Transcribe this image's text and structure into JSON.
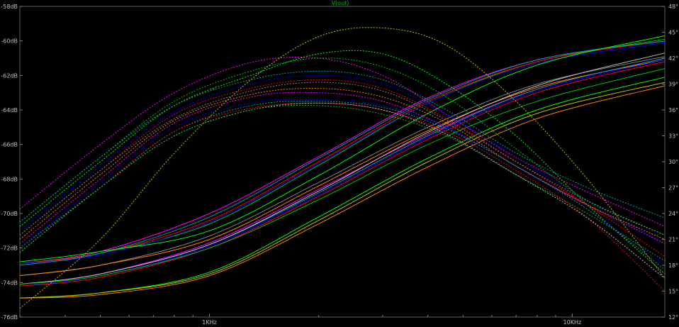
{
  "chart_data": {
    "type": "line",
    "title": "V(out)",
    "x_scale": "log",
    "xlim": [
      300,
      18000
    ],
    "x_ticks": [
      {
        "value": 1000,
        "label": "1KHz"
      },
      {
        "value": 10000,
        "label": "10KHz"
      }
    ],
    "y_left_lim": [
      -76,
      -58
    ],
    "y_left_ticks": [
      {
        "value": -58,
        "label": "-58dB"
      },
      {
        "value": -60,
        "label": "-60dB"
      },
      {
        "value": -62,
        "label": "-62dB"
      },
      {
        "value": -64,
        "label": "-64dB"
      },
      {
        "value": -66,
        "label": "-66dB"
      },
      {
        "value": -68,
        "label": "-68dB"
      },
      {
        "value": -70,
        "label": "-70dB"
      },
      {
        "value": -72,
        "label": "-72dB"
      },
      {
        "value": -74,
        "label": "-74dB"
      },
      {
        "value": -76,
        "label": "-76dB"
      }
    ],
    "y_right_lim": [
      12,
      48
    ],
    "y_right_ticks": [
      {
        "value": 48,
        "label": "48°"
      },
      {
        "value": 45,
        "label": "45°"
      },
      {
        "value": 42,
        "label": "42°"
      },
      {
        "value": 39,
        "label": "39°"
      },
      {
        "value": 36,
        "label": "36°"
      },
      {
        "value": 33,
        "label": "33°"
      },
      {
        "value": 30,
        "label": "30°"
      },
      {
        "value": 27,
        "label": "27°"
      },
      {
        "value": 24,
        "label": "24°"
      },
      {
        "value": 21,
        "label": "21°"
      },
      {
        "value": 18,
        "label": "18°"
      },
      {
        "value": 15,
        "label": "15°"
      },
      {
        "value": 12,
        "label": "12°"
      }
    ],
    "grid": false,
    "magnitude_series": [
      {
        "color": "#ff00ff",
        "x": [
          300,
          500,
          1000,
          2000,
          4000,
          8000,
          18000
        ],
        "y": [
          -72.9,
          -72.2,
          -70.0,
          -66.7,
          -63.3,
          -61.1,
          -60.0
        ]
      },
      {
        "color": "#00c000",
        "x": [
          300,
          500,
          1000,
          2000,
          4000,
          8000,
          18000
        ],
        "y": [
          -72.9,
          -72.3,
          -70.6,
          -67.2,
          -63.6,
          -61.2,
          -59.9
        ]
      },
      {
        "color": "#ff0000",
        "x": [
          300,
          500,
          1000,
          2000,
          4000,
          8000,
          18000
        ],
        "y": [
          -72.9,
          -72.3,
          -70.4,
          -67.0,
          -63.5,
          -61.2,
          -60.0
        ]
      },
      {
        "color": "#0000ff",
        "x": [
          300,
          500,
          1000,
          2000,
          4000,
          8000,
          18000
        ],
        "y": [
          -72.9,
          -72.4,
          -70.5,
          -67.1,
          -63.6,
          -61.3,
          -60.1
        ]
      },
      {
        "color": "#00a0a0",
        "x": [
          300,
          500,
          1000,
          2000,
          4000,
          8000,
          18000
        ],
        "y": [
          -73.0,
          -72.3,
          -70.2,
          -66.8,
          -63.4,
          -61.1,
          -60.0
        ]
      },
      {
        "color": "#00ff00",
        "x": [
          300,
          500,
          1000,
          2000,
          4000,
          8000,
          18000
        ],
        "y": [
          -72.8,
          -72.2,
          -71.0,
          -67.8,
          -64.2,
          -61.4,
          -59.7
        ]
      },
      {
        "color": "#808080",
        "x": [
          300,
          500,
          1000,
          2000,
          4000,
          8000,
          18000
        ],
        "y": [
          -73.6,
          -73.0,
          -71.3,
          -68.2,
          -65.0,
          -62.5,
          -60.9
        ]
      },
      {
        "color": "#ff8000",
        "x": [
          300,
          500,
          1000,
          2000,
          4000,
          8000,
          18000
        ],
        "y": [
          -73.6,
          -73.0,
          -71.5,
          -68.4,
          -65.2,
          -62.7,
          -61.1
        ]
      },
      {
        "color": "#ff00ff",
        "x": [
          300,
          500,
          1000,
          2000,
          4000,
          8000,
          18000
        ],
        "y": [
          -74.1,
          -73.5,
          -71.7,
          -68.6,
          -65.4,
          -62.8,
          -61.0
        ]
      },
      {
        "color": "#0000ff",
        "x": [
          300,
          500,
          1000,
          2000,
          4000,
          8000,
          18000
        ],
        "y": [
          -74.2,
          -73.6,
          -71.9,
          -68.9,
          -65.6,
          -62.9,
          -61.1
        ]
      },
      {
        "color": "#00a0a0",
        "x": [
          300,
          500,
          1000,
          2000,
          4000,
          8000,
          18000
        ],
        "y": [
          -74.1,
          -73.5,
          -71.8,
          -68.8,
          -65.5,
          -62.8,
          -61.0
        ]
      },
      {
        "color": "#ff0000",
        "x": [
          300,
          500,
          1000,
          2000,
          4000,
          8000,
          18000
        ],
        "y": [
          -74.2,
          -73.7,
          -72.0,
          -69.0,
          -65.7,
          -63.0,
          -61.2
        ]
      },
      {
        "color": "#c0c0c0",
        "x": [
          300,
          500,
          1000,
          2000,
          4000,
          8000,
          18000
        ],
        "y": [
          -74.1,
          -73.5,
          -71.8,
          -68.7,
          -65.3,
          -62.6,
          -60.7
        ]
      },
      {
        "color": "#00c000",
        "x": [
          300,
          500,
          1000,
          2000,
          4000,
          8000,
          18000
        ],
        "y": [
          -74.1,
          -73.6,
          -72.0,
          -69.2,
          -66.0,
          -63.5,
          -61.6
        ]
      },
      {
        "color": "#00ff00",
        "x": [
          300,
          500,
          1000,
          2000,
          4000,
          8000,
          18000
        ],
        "y": [
          -74.9,
          -74.6,
          -73.4,
          -70.2,
          -66.8,
          -64.0,
          -62.1
        ]
      },
      {
        "color": "#ff8000",
        "x": [
          300,
          500,
          1000,
          2000,
          4000,
          8000,
          18000
        ],
        "y": [
          -74.9,
          -74.7,
          -73.6,
          -70.6,
          -67.3,
          -64.5,
          -62.6
        ]
      },
      {
        "color": "#c0c000",
        "x": [
          300,
          500,
          1000,
          2000,
          4000,
          8000,
          18000
        ],
        "y": [
          -74.9,
          -74.6,
          -73.5,
          -70.4,
          -67.0,
          -64.2,
          -62.4
        ]
      }
    ],
    "phase_series": [
      {
        "color": "#ff00ff",
        "x": [
          300,
          500,
          800,
          1300,
          2000,
          3000,
          4500,
          7000,
          11000,
          18000
        ],
        "y": [
          24.5,
          32.0,
          38.0,
          41.5,
          42.0,
          40.0,
          35.5,
          30.5,
          26.5,
          22.5
        ]
      },
      {
        "color": "#00c000",
        "x": [
          300,
          500,
          800,
          1300,
          2000,
          3000,
          4500,
          7000,
          11000,
          18000
        ],
        "y": [
          23.0,
          30.5,
          37.0,
          40.5,
          42.0,
          41.0,
          37.5,
          31.5,
          25.5,
          21.5
        ]
      },
      {
        "color": "#00ff00",
        "x": [
          300,
          500,
          800,
          1300,
          2000,
          3000,
          4500,
          7000,
          11000,
          18000
        ],
        "y": [
          22.5,
          30.0,
          36.5,
          40.0,
          42.5,
          42.5,
          39.0,
          33.0,
          25.0,
          17.0
        ]
      },
      {
        "color": "#c0c000",
        "x": [
          300,
          500,
          800,
          1300,
          2000,
          3000,
          4500,
          7000,
          11000,
          18000
        ],
        "y": [
          13.0,
          21.0,
          31.0,
          39.5,
          44.5,
          45.5,
          43.5,
          37.0,
          28.0,
          16.5
        ]
      },
      {
        "color": "#ff0000",
        "x": [
          300,
          500,
          800,
          1300,
          2000,
          3000,
          4500,
          7000,
          11000,
          18000
        ],
        "y": [
          21.5,
          29.0,
          35.5,
          38.5,
          39.5,
          38.5,
          35.0,
          30.0,
          25.0,
          19.0
        ]
      },
      {
        "color": "#0000ff",
        "x": [
          300,
          500,
          800,
          1300,
          2000,
          3000,
          4500,
          7000,
          11000,
          18000
        ],
        "y": [
          22.0,
          29.5,
          35.8,
          39.0,
          40.0,
          39.0,
          35.5,
          30.5,
          25.5,
          20.5
        ]
      },
      {
        "color": "#00a0a0",
        "x": [
          300,
          500,
          800,
          1300,
          2000,
          3000,
          4500,
          7000,
          11000,
          18000
        ],
        "y": [
          23.0,
          30.5,
          36.5,
          39.5,
          40.5,
          39.5,
          36.0,
          31.0,
          27.0,
          23.5
        ]
      },
      {
        "color": "#ff8000",
        "x": [
          300,
          500,
          800,
          1300,
          2000,
          3000,
          4500,
          7000,
          11000,
          18000
        ],
        "y": [
          21.0,
          28.5,
          34.8,
          37.8,
          38.5,
          37.5,
          34.5,
          29.5,
          25.0,
          21.0
        ]
      },
      {
        "color": "#808080",
        "x": [
          300,
          500,
          800,
          1300,
          2000,
          3000,
          4500,
          7000,
          11000,
          18000
        ],
        "y": [
          21.5,
          29.0,
          35.0,
          38.2,
          39.2,
          38.2,
          34.8,
          30.0,
          25.5,
          21.5
        ]
      },
      {
        "color": "#ff00ff",
        "x": [
          300,
          500,
          800,
          1300,
          2000,
          3000,
          4500,
          7000,
          11000,
          18000
        ],
        "y": [
          20.5,
          28.0,
          34.5,
          37.5,
          38.0,
          37.0,
          34.0,
          29.5,
          25.0,
          20.5
        ]
      },
      {
        "color": "#0000ff",
        "x": [
          300,
          500,
          800,
          1300,
          2000,
          3000,
          4500,
          7000,
          11000,
          18000
        ],
        "y": [
          20.0,
          27.5,
          34.0,
          36.8,
          37.2,
          36.5,
          34.0,
          29.5,
          24.5,
          18.0
        ]
      },
      {
        "color": "#00a0a0",
        "x": [
          300,
          500,
          800,
          1300,
          2000,
          3000,
          4500,
          7000,
          11000,
          18000
        ],
        "y": [
          20.0,
          27.0,
          33.5,
          36.5,
          37.0,
          36.3,
          33.8,
          29.5,
          24.5,
          17.5
        ]
      },
      {
        "color": "#ff0000",
        "x": [
          300,
          500,
          800,
          1300,
          2000,
          3000,
          4500,
          7000,
          11000,
          18000
        ],
        "y": [
          19.5,
          27.0,
          33.5,
          36.2,
          36.8,
          36.0,
          33.5,
          29.0,
          23.5,
          15.0
        ]
      },
      {
        "color": "#c0c0c0",
        "x": [
          300,
          500,
          800,
          1300,
          2000,
          3000,
          4500,
          7000,
          11000,
          18000
        ],
        "y": [
          19.5,
          27.0,
          33.0,
          36.0,
          36.8,
          36.0,
          33.2,
          28.5,
          23.5,
          16.5
        ]
      },
      {
        "color": "#00c000",
        "x": [
          300,
          500,
          800,
          1300,
          2000,
          3000,
          4500,
          7000,
          11000,
          18000
        ],
        "y": [
          19.5,
          27.0,
          33.0,
          36.0,
          36.5,
          35.5,
          33.0,
          28.5,
          24.0,
          18.5
        ]
      }
    ]
  }
}
